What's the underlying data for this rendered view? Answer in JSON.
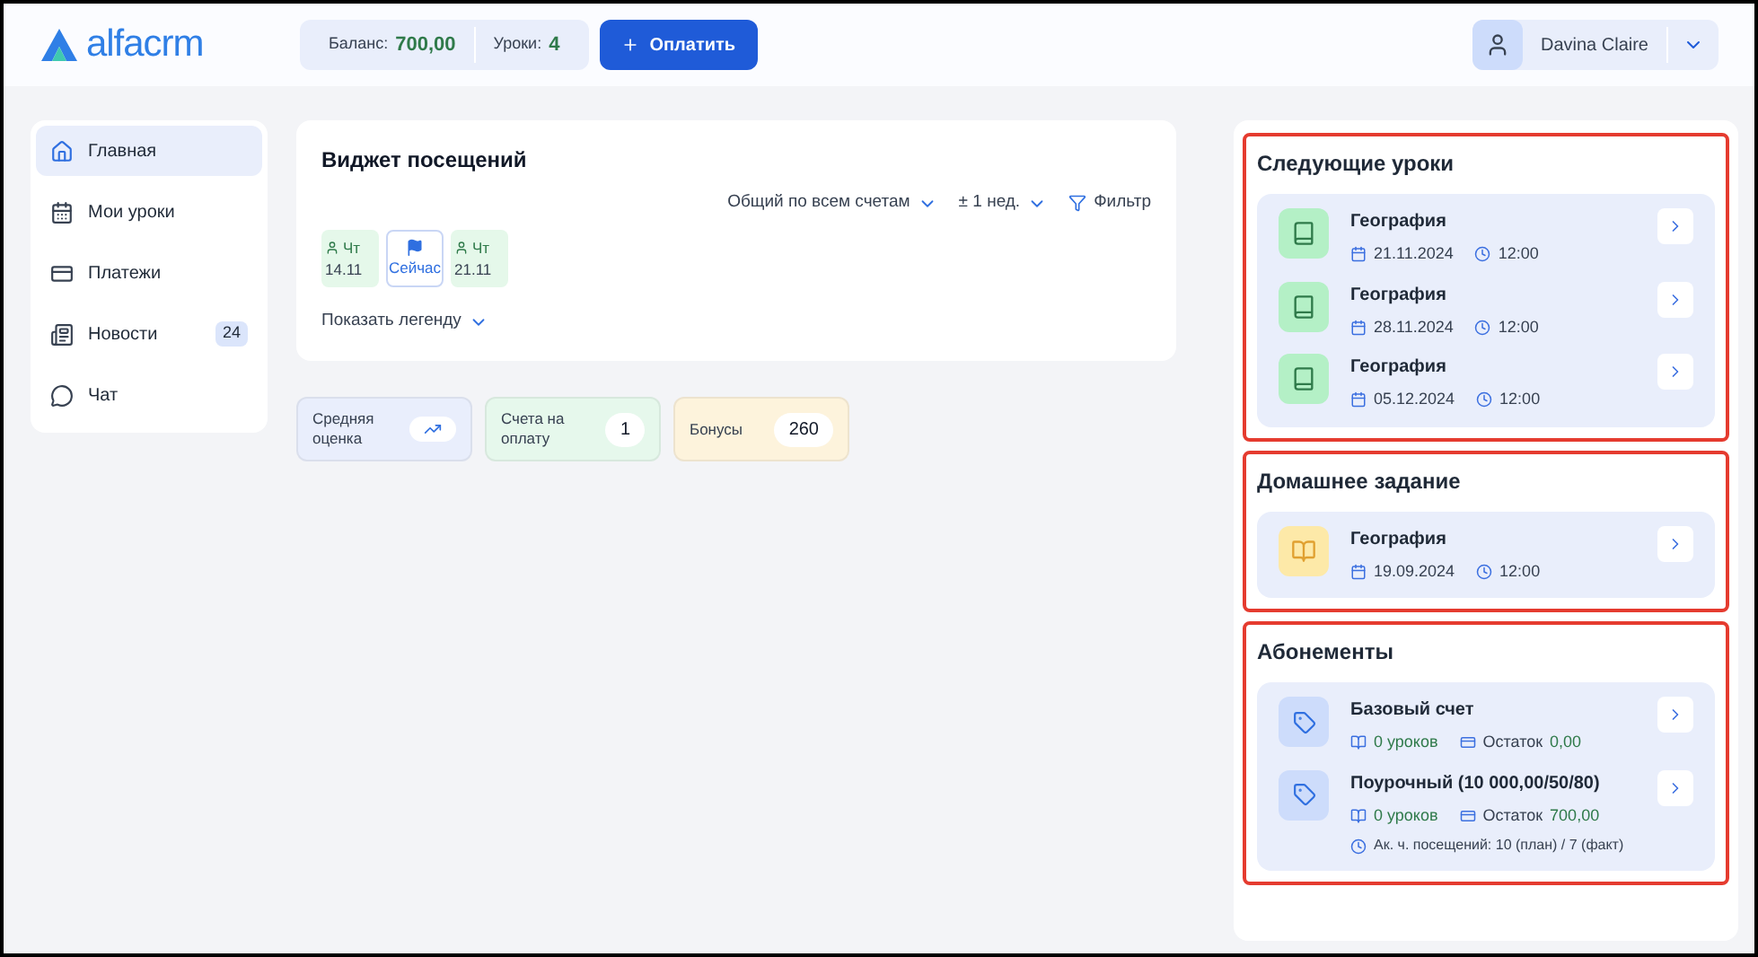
{
  "header": {
    "logo": "alfacrm",
    "balance_label": "Баланс:",
    "balance": "700,00",
    "lessons_label": "Уроки:",
    "lessons": "4",
    "pay_button": "Оплатить",
    "user": "Davina Claire"
  },
  "sidebar": {
    "items": [
      {
        "label": "Главная",
        "selected": true
      },
      {
        "label": "Мои уроки",
        "selected": false
      },
      {
        "label": "Платежи",
        "selected": false
      },
      {
        "label": "Новости",
        "selected": false,
        "badge": "24"
      },
      {
        "label": "Чат",
        "selected": false
      }
    ]
  },
  "widget": {
    "title": "Виджет посещений",
    "filters": [
      {
        "label": "Общий по всем счетам",
        "kind": "dropdown"
      },
      {
        "label": "± 1 нед.",
        "kind": "dropdown"
      },
      {
        "label": "Фильтр",
        "kind": "filter"
      }
    ],
    "days": [
      {
        "kind": "lesson",
        "day": "Чт",
        "date": "14.11"
      },
      {
        "kind": "now",
        "label": "Сейчас"
      },
      {
        "kind": "lesson",
        "day": "Чт",
        "date": "21.11"
      }
    ],
    "legend_toggle": "Показать легенду"
  },
  "stats": [
    {
      "kind": "trend",
      "label": "Средняя оценка",
      "color": "#e9eefc"
    },
    {
      "kind": "count",
      "label": "Счета на оплату",
      "value": "1",
      "color": "#e6f8ec"
    },
    {
      "kind": "count",
      "label": "Бонусы",
      "value": "260",
      "color": "#fdf3dc"
    }
  ],
  "next_lessons": {
    "title": "Следующие уроки",
    "highlighted": true,
    "items": [
      {
        "kind": "lesson",
        "subject": "География",
        "date": "21.11.2024",
        "time": "12:00"
      },
      {
        "kind": "lesson",
        "subject": "География",
        "date": "28.11.2024",
        "time": "12:00"
      },
      {
        "kind": "lesson",
        "subject": "География",
        "date": "05.12.2024",
        "time": "12:00"
      }
    ]
  },
  "homework": {
    "title": "Домашнее задание",
    "highlighted": true,
    "items": [
      {
        "kind": "homework",
        "subject": "География",
        "date": "19.09.2024",
        "time": "12:00"
      }
    ]
  },
  "subscriptions": {
    "title": "Абонементы",
    "highlighted": true,
    "items": [
      {
        "name": "Базовый счет",
        "lessons": "0 уроков",
        "balance_label": "Остаток",
        "balance": "0,00"
      },
      {
        "name": "Поурочный (10 000,00/50/80)",
        "lessons": "0 уроков",
        "balance_label": "Остаток",
        "balance": "700,00",
        "visits": "Ак. ч. посещений: 10 (план) / 7 (факт)"
      }
    ]
  }
}
